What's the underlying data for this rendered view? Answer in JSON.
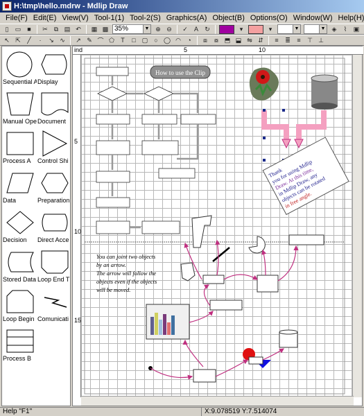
{
  "window": {
    "title": "H:\\tmp\\hello.mdrw - Mdlip Draw"
  },
  "menu": [
    "File(F)",
    "Edit(E)",
    "View(V)",
    "Tool-1(1)",
    "Tool-2(S)",
    "Graphics(A)",
    "Object(B)",
    "Options(O)",
    "Window(W)",
    "Help(H)"
  ],
  "toolbar": {
    "zoom": "35%",
    "line_color": "#a000a0",
    "fill_color": "#f4a0a0"
  },
  "palette": [
    "Sequential A",
    "Display",
    "Manual Ope",
    "Document",
    "Process A",
    "Control Shi",
    "Data",
    "Preparation",
    "Decision",
    "Direct Acce",
    "Stored Data",
    "Loop End T",
    "Loop Begin",
    "Comunicati",
    "Process B"
  ],
  "ruler": {
    "top": [
      "ind",
      "5",
      "10"
    ],
    "left": [
      "5",
      "10",
      "15"
    ]
  },
  "drawing": {
    "banner": "How to use the Clip",
    "note_lines": [
      "You can joint two objects",
      "by an arrow.",
      "The arrow will follow the",
      "objects even if the objects",
      "will be moved."
    ],
    "thanks_lines": [
      "Thank",
      "you for using Mdlip",
      "Draw. At this time,",
      "in Mdlip Draw, any",
      "objects can be rotated",
      "in free angle."
    ]
  },
  "status": {
    "help": "Help \"F1\"",
    "coords": "X:9.078519  Y:7.514074"
  }
}
